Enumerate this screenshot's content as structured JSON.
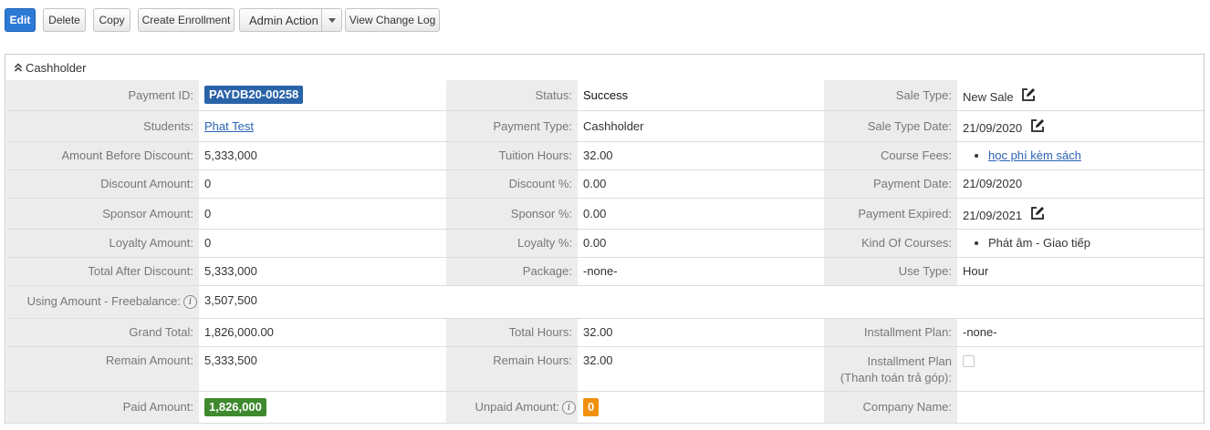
{
  "toolbar": {
    "edit": "Edit",
    "delete": "Delete",
    "copy": "Copy",
    "create_enrollment": "Create Enrollment",
    "admin_action": "Admin Action",
    "view_change_log": "View Change Log"
  },
  "section": {
    "title": "Cashholder"
  },
  "fields": {
    "payment_id": {
      "label": "Payment ID:",
      "value": "PAYDB20-00258"
    },
    "status": {
      "label": "Status:",
      "value": "Success"
    },
    "sale_type": {
      "label": "Sale Type:",
      "value": "New Sale"
    },
    "students": {
      "label": "Students:",
      "value": "Phat Test"
    },
    "payment_type": {
      "label": "Payment Type:",
      "value": "Cashholder"
    },
    "sale_type_date": {
      "label": "Sale Type Date:",
      "value": "21/09/2020"
    },
    "amount_before_discount": {
      "label": "Amount Before Discount:",
      "value": "5,333,000"
    },
    "tuition_hours": {
      "label": "Tuition Hours:",
      "value": "32.00"
    },
    "course_fees": {
      "label": "Course Fees:",
      "value": "học phí kèm sách"
    },
    "discount_amount": {
      "label": "Discount Amount:",
      "value": "0"
    },
    "discount_pct": {
      "label": "Discount %:",
      "value": "0.00"
    },
    "payment_date": {
      "label": "Payment Date:",
      "value": "21/09/2020"
    },
    "sponsor_amount": {
      "label": "Sponsor Amount:",
      "value": "0"
    },
    "sponsor_pct": {
      "label": "Sponsor %:",
      "value": "0.00"
    },
    "payment_expired": {
      "label": "Payment Expired:",
      "value": "21/09/2021"
    },
    "loyalty_amount": {
      "label": "Loyalty Amount:",
      "value": "0"
    },
    "loyalty_pct": {
      "label": "Loyalty %:",
      "value": "0.00"
    },
    "kind_of_courses": {
      "label": "Kind Of Courses:",
      "value": "Phát âm - Giao tiếp"
    },
    "total_after_discount": {
      "label": "Total After Discount:",
      "value": "5,333,000"
    },
    "package": {
      "label": "Package:",
      "value": "-none-"
    },
    "use_type": {
      "label": "Use Type:",
      "value": "Hour"
    },
    "using_amount_freebalance": {
      "label": "Using Amount - Freebalance:",
      "value": "3,507,500"
    },
    "grand_total": {
      "label": "Grand Total:",
      "value": "1,826,000.00"
    },
    "total_hours": {
      "label": "Total Hours:",
      "value": "32.00"
    },
    "installment_plan": {
      "label": "Installment Plan:",
      "value": "-none-"
    },
    "remain_amount": {
      "label": "Remain Amount:",
      "value": "5,333,500"
    },
    "remain_hours": {
      "label": "Remain Hours:",
      "value": "32.00"
    },
    "installment_plan_vn": {
      "label_line1": "Installment Plan",
      "label_line2": "(Thanh toán trả góp):"
    },
    "paid_amount": {
      "label": "Paid Amount:",
      "value": "1,826,000"
    },
    "unpaid_amount": {
      "label": "Unpaid Amount:",
      "value": "0"
    },
    "company_name": {
      "label": "Company Name:",
      "value": ""
    }
  },
  "icons": {
    "info": "info-icon",
    "edit": "edit-icon",
    "collapse": "chevron-double-up-icon",
    "dropdown": "caret-down-icon"
  },
  "colors": {
    "primary_button": "#2d79d6",
    "payment_id_badge": "#2a63a8",
    "paid_badge": "#3f8a2e",
    "unpaid_badge": "#f0900c",
    "link": "#2a62b6",
    "label_bg": "#ececec"
  }
}
